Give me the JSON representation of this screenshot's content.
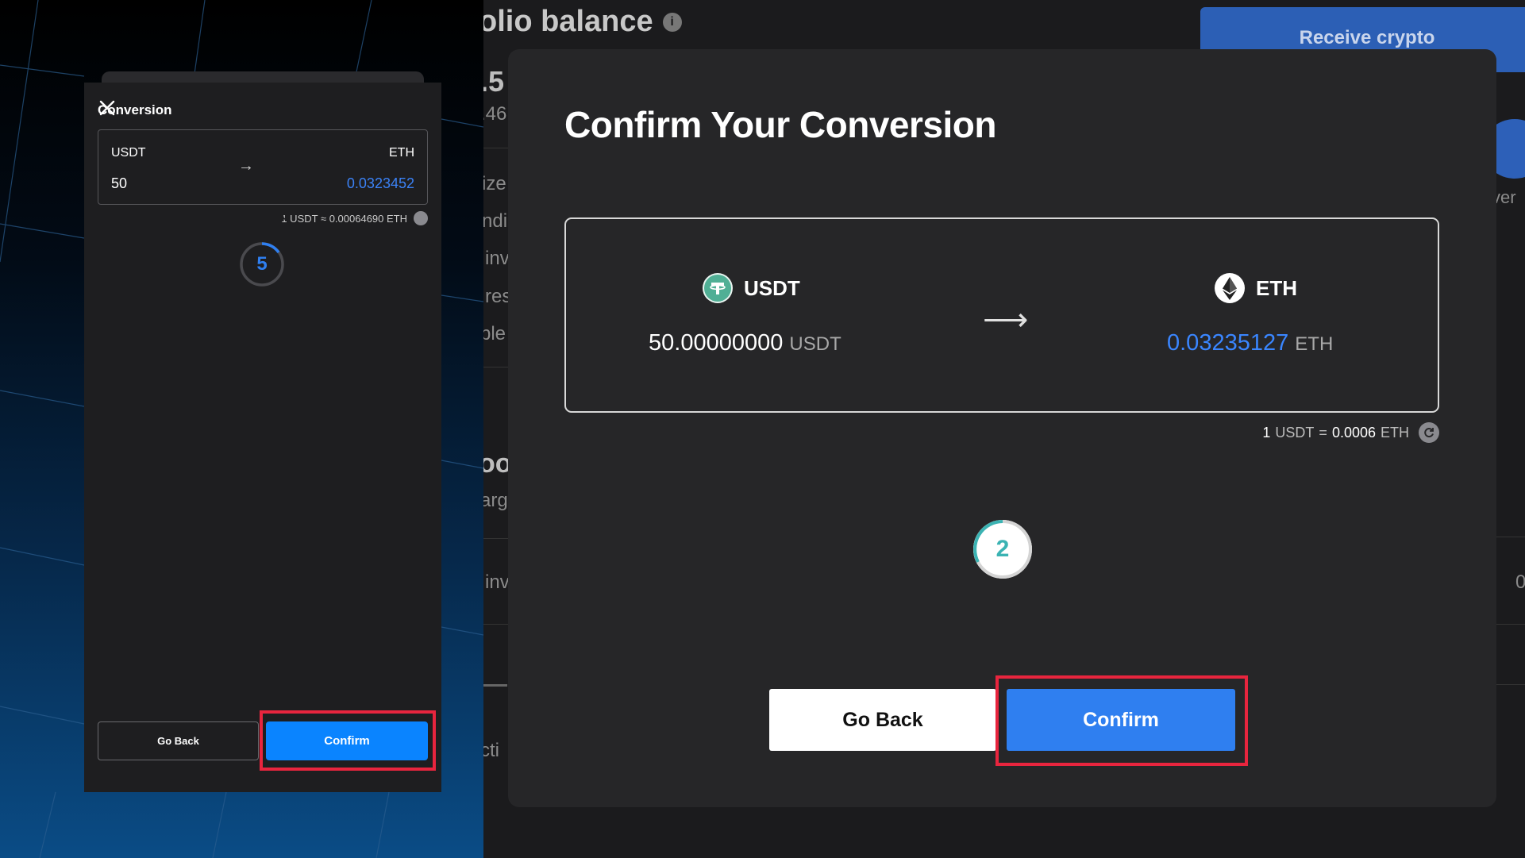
{
  "mobile": {
    "title": "Conversion",
    "from": {
      "symbol": "USDT",
      "amount": "50"
    },
    "to": {
      "symbol": "ETH",
      "amount": "0.0323452"
    },
    "arrow": "→",
    "rate": "1 USDT ≈ 0.00064690 ETH",
    "countdown": "5",
    "go_back_label": "Go Back",
    "confirm_label": "Confirm"
  },
  "background": {
    "title_fragment": "olio balance",
    "receive_label": "Receive crypto",
    "fragments": [
      ".5",
      ".46",
      "ize",
      "ndi",
      "inv",
      "res",
      "ble",
      "oo",
      "arg",
      "inv",
      "cti",
      "ver",
      "0"
    ]
  },
  "modal": {
    "title": "Confirm Your Conversion",
    "from": {
      "symbol": "USDT",
      "amount": "50.00000000",
      "unit": "USDT"
    },
    "to": {
      "symbol": "ETH",
      "amount": "0.03235127",
      "unit": "ETH"
    },
    "arrow": "⟶",
    "rate": {
      "prefix": "1",
      "from_unit": "USDT",
      "eq": "=",
      "value": "0.0006",
      "to_unit": "ETH"
    },
    "countdown": "2",
    "go_back_label": "Go Back",
    "confirm_label": "Confirm"
  },
  "colors": {
    "accent_blue": "#2f7ff0",
    "highlight_red": "#e8253e",
    "tether_green": "#50af95",
    "timer_teal": "#3bb3b3"
  },
  "icons": {
    "close": "close-icon",
    "info": "info-icon",
    "refresh": "refresh-icon",
    "tether": "tether-logo-icon",
    "ethereum": "ethereum-logo-icon"
  }
}
